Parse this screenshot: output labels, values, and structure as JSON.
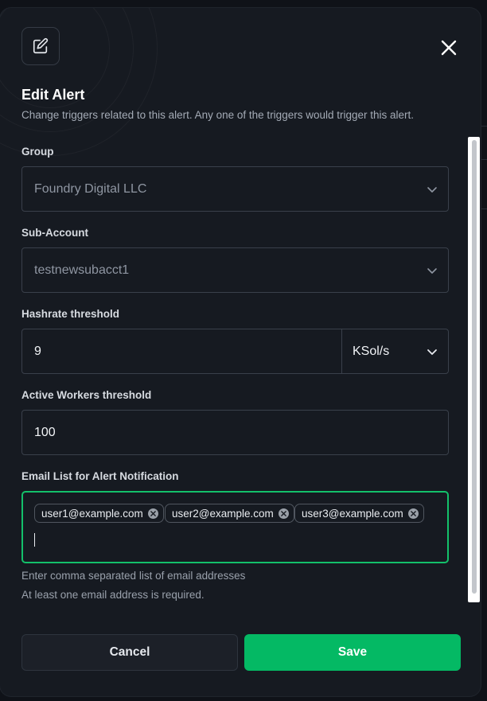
{
  "modal": {
    "title": "Edit Alert",
    "subtitle": "Change triggers related to this alert. Any one of the triggers would trigger this alert."
  },
  "icons": {
    "header": "edit-square-icon",
    "close": "close-icon",
    "chevron": "chevron-down-icon",
    "chip_remove": "remove-circle-icon"
  },
  "fields": {
    "group": {
      "label": "Group",
      "value": "Foundry Digital LLC"
    },
    "sub_account": {
      "label": "Sub-Account",
      "value": "testnewsubacct1"
    },
    "hashrate": {
      "label": "Hashrate threshold",
      "value": "9",
      "unit": "KSol/s"
    },
    "active_workers": {
      "label": "Active Workers threshold",
      "value": "100"
    },
    "email_list": {
      "label": "Email List for Alert Notification",
      "chips": [
        "user1@example.com",
        "user2@example.com",
        "user3@example.com"
      ],
      "hint": "Enter comma separated list of email addresses",
      "error": "At least one email address is required."
    }
  },
  "buttons": {
    "cancel": "Cancel",
    "save": "Save"
  },
  "colors": {
    "accent": "#04b964",
    "focus_border": "#13c06a",
    "modal_bg": "#161a21"
  }
}
